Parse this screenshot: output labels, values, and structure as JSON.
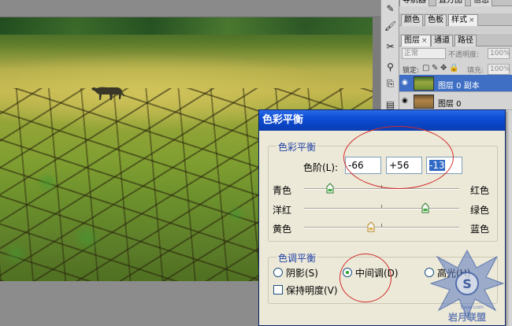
{
  "panels": {
    "top_tabs": [
      {
        "label": "导航器"
      },
      {
        "label": "直方图"
      },
      {
        "label": "信息"
      }
    ],
    "swatch_tabs": [
      {
        "label": "颜色",
        "active": false
      },
      {
        "label": "色板",
        "active": false
      },
      {
        "label": "样式",
        "active": true,
        "close": "×"
      }
    ],
    "layer_tabs": [
      {
        "label": "图层",
        "active": true,
        "close": "×"
      },
      {
        "label": "通道",
        "active": false
      },
      {
        "label": "路径",
        "active": false
      }
    ],
    "blend_mode": "正常",
    "opacity_label": "不透明度:",
    "opacity_value": "100%",
    "lock_label": "锁定:",
    "fill_label": "填充:",
    "fill_value": "100%",
    "layers": [
      {
        "name": "图层 0 副本",
        "selected": true
      },
      {
        "name": "图层 0",
        "selected": false
      }
    ]
  },
  "dialog": {
    "title": "色彩平衡",
    "balance_group": {
      "legend": "色彩平衡",
      "levels_label": "色阶(L):",
      "levels": [
        "-66",
        "+56",
        "-13"
      ],
      "sliders": [
        {
          "left": "青色",
          "right": "红色",
          "value": -66
        },
        {
          "left": "洋红",
          "right": "绿色",
          "value": 56
        },
        {
          "left": "黄色",
          "right": "蓝色",
          "value": -13
        }
      ]
    },
    "tone_group": {
      "legend": "色调平衡",
      "options": [
        {
          "label": "阴影(S)",
          "selected": false
        },
        {
          "label": "中间调(D)",
          "selected": true
        },
        {
          "label": "高光(H)",
          "selected": false
        }
      ],
      "preserve_label": "保持明度(V)",
      "preserve_checked": false
    }
  },
  "watermark": {
    "text": "岩月联盟",
    "subtext": "5yue.com"
  },
  "colors": {
    "title_bar": "#0a44c4",
    "dialog_bg": "#ece9d8",
    "legend_blue": "#1f3fa5",
    "annotation_red": "#d12a2a",
    "layer_selected": "#3f6fc4"
  }
}
